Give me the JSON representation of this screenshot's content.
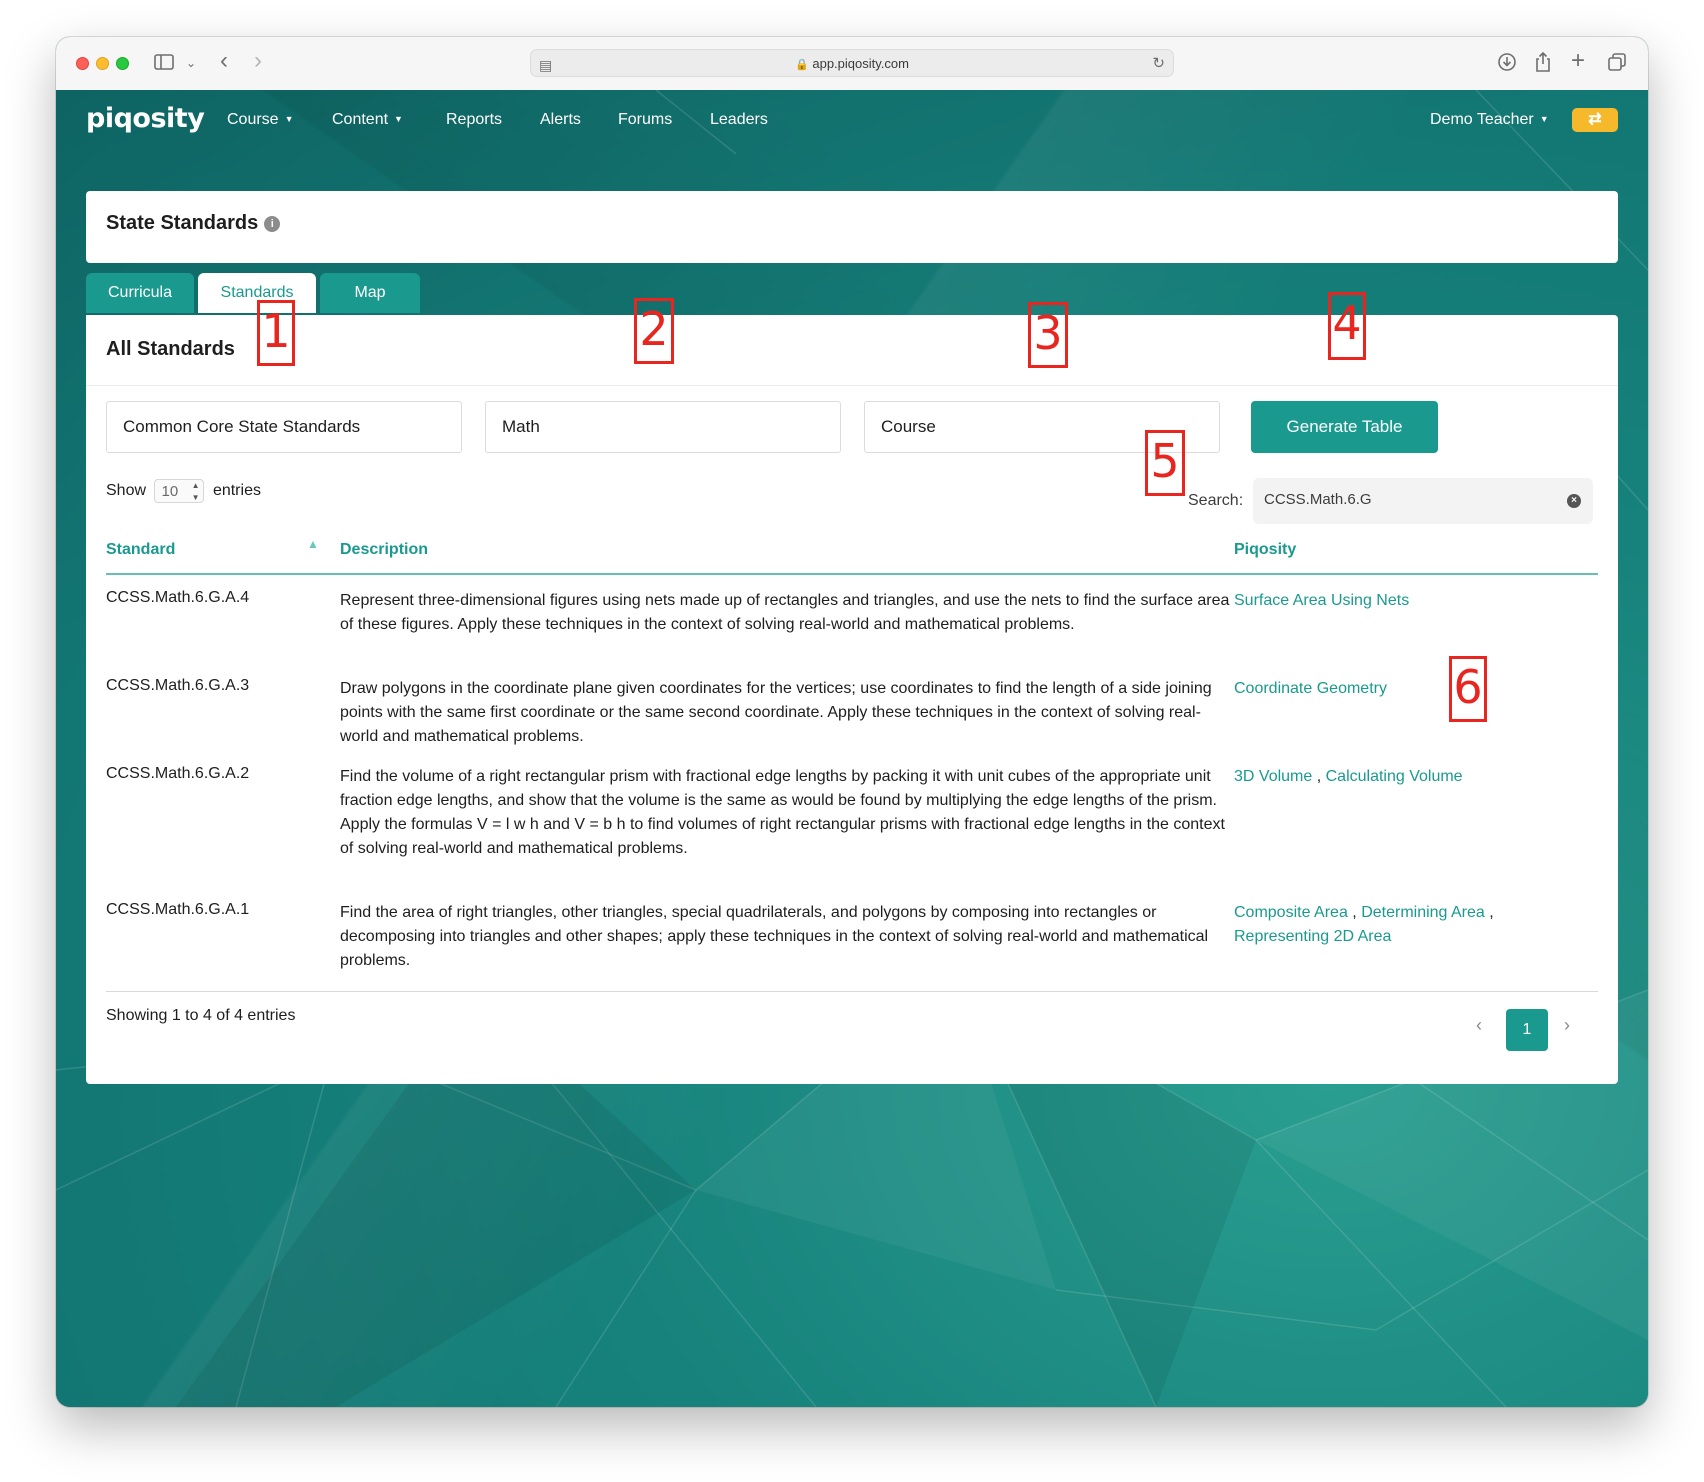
{
  "browser": {
    "url": "app.piqosity.com"
  },
  "nav": {
    "logo": "piqosity",
    "items": [
      {
        "label": "Course",
        "dropdown": true
      },
      {
        "label": "Content",
        "dropdown": true
      },
      {
        "label": "Reports"
      },
      {
        "label": "Alerts"
      },
      {
        "label": "Forums"
      },
      {
        "label": "Leaders"
      }
    ],
    "user": "Demo Teacher",
    "accent": "#1a9a8f",
    "refresh_color": "#f5b92b"
  },
  "page": {
    "title": "State Standards",
    "info_icon": "i"
  },
  "tabs": [
    {
      "label": "Curricula",
      "active": false
    },
    {
      "label": "Standards",
      "active": true
    },
    {
      "label": "Map",
      "active": false
    }
  ],
  "section": {
    "title": "All Standards",
    "filters": {
      "standards_set": "Common Core State Standards",
      "subject": "Math",
      "course": "Course"
    },
    "generate_label": "Generate Table",
    "show_label": "Show",
    "entries_value": "10",
    "entries_label": "entries",
    "search_label": "Search:",
    "search_value": "CCSS.Math.6.G"
  },
  "table": {
    "headers": [
      "Standard",
      "Description",
      "Piqosity"
    ],
    "rows": [
      {
        "standard": "CCSS.Math.6.G.A.4",
        "description": "Represent three-dimensional figures using nets made up of rectangles and triangles, and use the nets to find the surface area of these figures. Apply these techniques in the context of solving real-world and mathematical problems.",
        "links": [
          "Surface Area Using Nets"
        ]
      },
      {
        "standard": "CCSS.Math.6.G.A.3",
        "description": "Draw polygons in the coordinate plane given coordinates for the vertices; use coordinates to find the length of a side joining points with the same first coordinate or the same second coordinate. Apply these techniques in the context of solving real-world and mathematical problems.",
        "links": [
          "Coordinate Geometry"
        ]
      },
      {
        "standard": "CCSS.Math.6.G.A.2",
        "description": "Find the volume of a right rectangular prism with fractional edge lengths by packing it with unit cubes of the appropriate unit fraction edge lengths, and show that the volume is the same as would be found by multiplying the edge lengths of the prism. Apply the formulas V = l w h and V = b h to find volumes of right rectangular prisms with fractional edge lengths in the context of solving real-world and mathematical problems.",
        "links": [
          "3D Volume",
          "Calculating Volume"
        ]
      },
      {
        "standard": "CCSS.Math.6.G.A.1",
        "description": "Find the area of right triangles, other triangles, special quadrilaterals, and polygons by composing into rectangles or decomposing into triangles and other shapes; apply these techniques in the context of solving real-world and mathematical problems.",
        "links": [
          "Composite Area",
          "Determining Area",
          "Representing 2D Area"
        ]
      }
    ],
    "footer": "Showing 1 to 4 of 4 entries",
    "page": "1"
  },
  "annotations": [
    "1",
    "2",
    "3",
    "4",
    "5",
    "6"
  ]
}
